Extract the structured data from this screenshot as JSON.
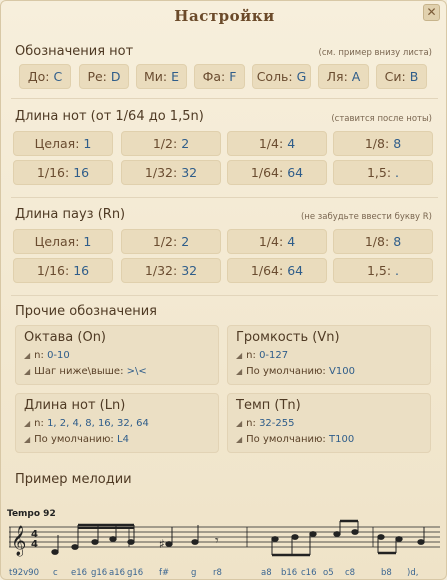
{
  "window": {
    "title": "Настройки",
    "close_label": "✕"
  },
  "note_names": {
    "title": "Обозначения нот",
    "note": "(см. пример внизу листа)",
    "buttons": [
      {
        "label": "До:",
        "value": "C"
      },
      {
        "label": "Ре:",
        "value": "D"
      },
      {
        "label": "Ми:",
        "value": "E"
      },
      {
        "label": "Фа:",
        "value": "F"
      },
      {
        "label": "Соль:",
        "value": "G"
      },
      {
        "label": "Ля:",
        "value": "A"
      },
      {
        "label": "Си:",
        "value": "B"
      }
    ]
  },
  "note_length": {
    "title": "Длина нот (от 1/64 до 1,5n)",
    "note": "(ставится после ноты)",
    "buttons": [
      {
        "label": "Целая:",
        "value": "1"
      },
      {
        "label": "1/2:",
        "value": "2"
      },
      {
        "label": "1/4:",
        "value": "4"
      },
      {
        "label": "1/8:",
        "value": "8"
      },
      {
        "label": "1/16:",
        "value": "16"
      },
      {
        "label": "1/32:",
        "value": "32"
      },
      {
        "label": "1/64:",
        "value": "64"
      },
      {
        "label": "1,5:",
        "value": "."
      }
    ]
  },
  "pause_length": {
    "title": "Длина пауз (Rn)",
    "note": "(не забудьте ввести букву R)",
    "buttons": [
      {
        "label": "Целая:",
        "value": "1"
      },
      {
        "label": "1/2:",
        "value": "2"
      },
      {
        "label": "1/4:",
        "value": "4"
      },
      {
        "label": "1/8:",
        "value": "8"
      },
      {
        "label": "1/16:",
        "value": "16"
      },
      {
        "label": "1/32:",
        "value": "32"
      },
      {
        "label": "1/64:",
        "value": "64"
      },
      {
        "label": "1,5:",
        "value": "."
      }
    ]
  },
  "other": {
    "title": "Прочие обозначения",
    "boxes": [
      {
        "title": "Октава (On)",
        "lines": [
          {
            "label": "n:",
            "value": "0-10"
          },
          {
            "label": "Шаг ниже\\выше:",
            "value": ">\\<"
          }
        ]
      },
      {
        "title": "Громкость (Vn)",
        "lines": [
          {
            "label": "n:",
            "value": "0-127"
          },
          {
            "label": "По умолчанию:",
            "value": "V100"
          }
        ]
      },
      {
        "title": "Длина нот (Ln)",
        "lines": [
          {
            "label": "n:",
            "value": "1, 2, 4, 8, 16, 32, 64"
          },
          {
            "label": "По умолчанию:",
            "value": "L4"
          }
        ]
      },
      {
        "title": "Темп (Tn)",
        "lines": [
          {
            "label": "n:",
            "value": "32-255"
          },
          {
            "label": "По умолчанию:",
            "value": "T100"
          }
        ]
      }
    ]
  },
  "example": {
    "title": "Пример мелодии",
    "tempo_label": "Tempo 92",
    "note_labels": [
      "t92v90",
      "c",
      "e16",
      "g16",
      "a16",
      "g16",
      "f#",
      "g",
      "r8",
      "a8",
      "b16",
      "c16",
      "o5",
      "c8",
      "b8",
      ")d,"
    ]
  },
  "colors": {
    "accent": "#2f5d8a",
    "background": "#f4ecd9",
    "button": "#eadcbd"
  }
}
